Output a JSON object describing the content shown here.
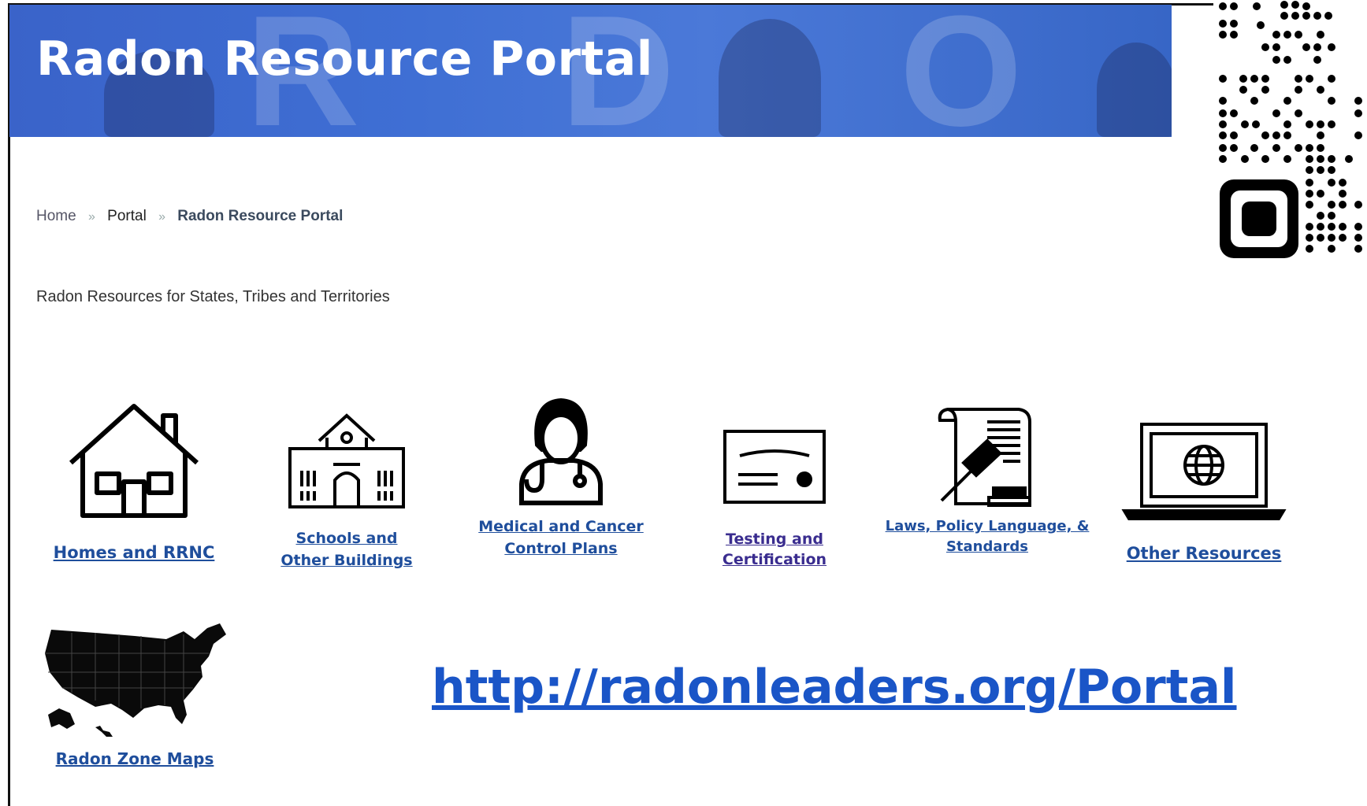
{
  "banner": {
    "title": "Radon Resource Portal"
  },
  "breadcrumb": {
    "home": "Home",
    "sep": "»",
    "portal": "Portal",
    "current": "Radon Resource Portal"
  },
  "subtitle": "Radon Resources for States, Tribes and Territories",
  "tiles": [
    {
      "line1": "Homes and RRNC",
      "line2": "",
      "icon": "house-icon"
    },
    {
      "line1": "Schools and",
      "line2": "Other Buildings",
      "icon": "school-icon"
    },
    {
      "line1": "Medical and Cancer",
      "line2": "Control Plans",
      "icon": "doctor-icon"
    },
    {
      "line1": "Testing and",
      "line2": "Certification",
      "icon": "certificate-icon"
    },
    {
      "line1": "Laws, Policy Language, &",
      "line2": "Standards",
      "icon": "gavel-document-icon"
    },
    {
      "line1": "Other Resources",
      "line2": "",
      "icon": "laptop-globe-icon"
    },
    {
      "line1": "Radon Zone Maps",
      "line2": "",
      "icon": "us-map-icon"
    }
  ],
  "url": "http://radonleaders.org/Portal",
  "colors": {
    "banner": "#3f6fd4",
    "link": "#1f4e9c",
    "url": "#1a55c7"
  }
}
